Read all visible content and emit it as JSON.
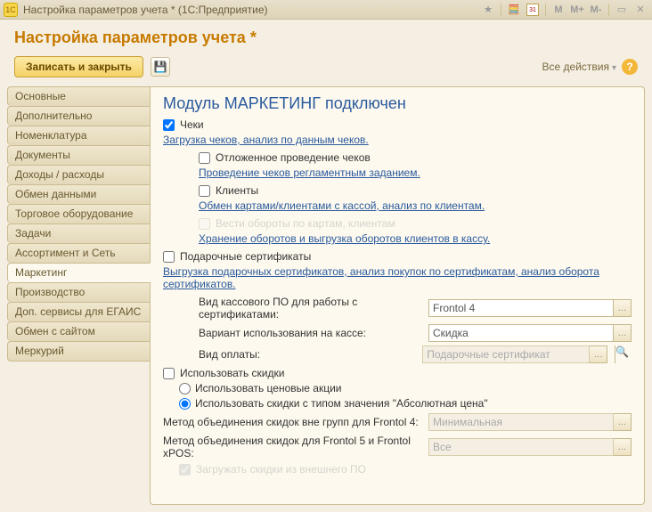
{
  "titlebar": {
    "app_icon_text": "1C",
    "title": "Настройка параметров учета *   (1С:Предприятие)",
    "cal_text": "31",
    "m1": "M",
    "m2": "M+",
    "m3": "M-"
  },
  "header": {
    "title": "Настройка параметров учета *"
  },
  "toolbar": {
    "save_close": "Записать и закрыть",
    "all_actions": "Все действия",
    "help": "?"
  },
  "tabs": [
    "Основные",
    "Дополнительно",
    "Номенклатура",
    "Документы",
    "Доходы / расходы",
    "Обмен данными",
    "Торговое оборудование",
    "Задачи",
    "Ассортимент и Сеть",
    "Маркетинг",
    "Производство",
    "Доп. сервисы для ЕГАИС",
    "Обмен с сайтом",
    "Меркурий"
  ],
  "active_tab_index": 9,
  "panel": {
    "heading": "Модуль МАРКЕТИНГ подключен",
    "cheki": {
      "label": "Чеки",
      "checked": true
    },
    "cheki_desc": "Загрузка чеков, анализ по данным чеков.",
    "deferred": {
      "label": "Отложенное проведение чеков",
      "checked": false
    },
    "deferred_link": "Проведение чеков регламентным заданием.",
    "clients": {
      "label": "Клиенты",
      "checked": false
    },
    "clients_link": "Обмен картами/клиентами с кассой, анализ по клиентам.",
    "turnover": {
      "label": "Вести обороты по картам, клиентам",
      "checked": false
    },
    "turnover_link": "Хранение оборотов и выгрузка оборотов клиентов в кассу.",
    "gift": {
      "label": "Подарочные сертификаты",
      "checked": false
    },
    "gift_desc": "Выгрузка подарочных сертификатов, анализ покупок по сертификатам, анализ оборота сертификатов.",
    "cert_soft_label": "Вид кассового ПО для работы с сертификатами:",
    "cert_soft_value": "Frontol 4",
    "usage_label": "Вариант использования на кассе:",
    "usage_value": "Скидка",
    "pay_label": "Вид оплаты:",
    "pay_value": "Подарочные сертификат",
    "use_discounts": {
      "label": "Использовать скидки",
      "checked": false
    },
    "radio_price": "Использовать ценовые акции",
    "radio_abs": "Использовать скидки с типом значения \"Абсолютная цена\"",
    "merge_out_label": "Метод объединения скидок вне групп для Frontol 4:",
    "merge_out_value": "Минимальная",
    "merge_f5_label": "Метод объединения скидок для Frontol 5 и Frontol xPOS:",
    "merge_f5_value": "Все",
    "load_ext": {
      "label": "Загружать скидки из внешнего ПО",
      "checked": true
    }
  }
}
